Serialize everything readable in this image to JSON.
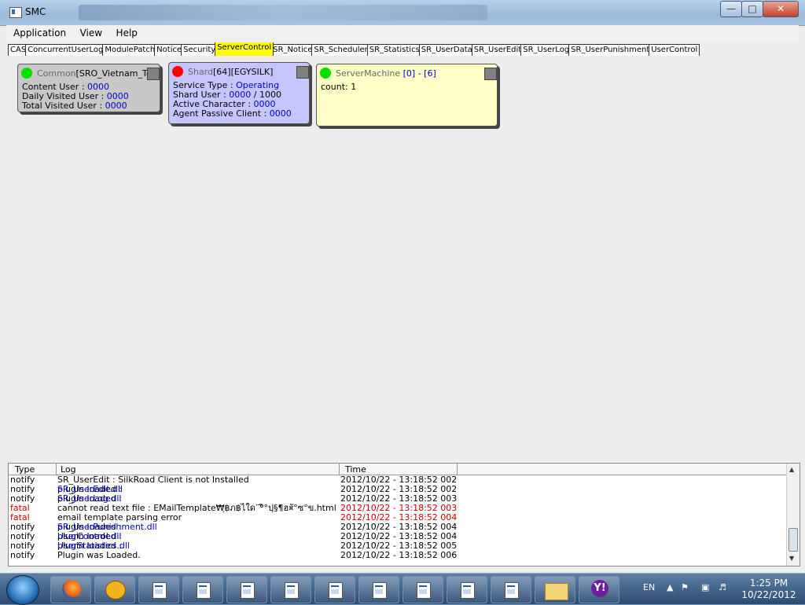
{
  "window": {
    "title": "SMC"
  },
  "menu": [
    "Application",
    "View",
    "Help"
  ],
  "tabs": [
    "CAS",
    "ConcurrentUserLog",
    "ModulePatch",
    "Notice",
    "Security",
    "ServerControl",
    "SR_Notice",
    "SR_Scheduler",
    "SR_Statistics",
    "SR_UserData",
    "SR_UserEdit",
    "SR_UserLog",
    "SR_UserPunishment",
    "UserControl"
  ],
  "active_tab": "ServerControl",
  "cards": {
    "common": {
      "status_color": "#00e000",
      "name_prefix": "Common",
      "name": "[SRO_Vietnam_TestLo",
      "content_user_label": "Content User : ",
      "content_user": "0000",
      "daily_visited_label": "Daily Visited User : ",
      "daily_visited": "0000",
      "total_visited_label": "Total Visited User : ",
      "total_visited": "0000"
    },
    "shard": {
      "status_color": "#ff0000",
      "name_prefix": "Shard",
      "id": "[64]",
      "name": "[EGYSILK]",
      "service_type_label": "Service Type : ",
      "service_type": "Operating",
      "shard_user_label": "Shard User : ",
      "shard_user": "0000",
      "shard_user_max": " / 1000",
      "active_char_label": "Active Character : ",
      "active_char": "0000",
      "agent_passive_label": "Agent Passive Client : ",
      "agent_passive": "0000"
    },
    "machine": {
      "status_color": "#00e000",
      "name_prefix": "ServerMachine ",
      "range": "[0] - [6]",
      "count": "count: 1"
    }
  },
  "log": {
    "headers": {
      "type": "Type",
      "log": "Log",
      "time": "Time"
    },
    "rows": [
      {
        "type": "notify",
        "pre": "SR_UserEdit : SilkRoad Client is not Installed",
        "link": "",
        "time": "2012/10/22 - 13:18:52 002",
        "level": "notify"
      },
      {
        "type": "notify",
        "pre": "plugin loaded : ",
        "link": "SR_UserEdit.dll",
        "time": "2012/10/22 - 13:18:52 002",
        "level": "notify"
      },
      {
        "type": "notify",
        "pre": "plugin loaded : ",
        "link": "SR_UserLog.dll",
        "time": "2012/10/22 - 13:18:52 003",
        "level": "notify"
      },
      {
        "type": "fatal",
        "pre": "cannot read text file : EMailTemplate₩ฺ฿ภ฿ไใด¨°ิ°ปฺ§¶ฮ¤ั°ซ°ข.html",
        "link": "",
        "time": "2012/10/22 - 13:18:52 003",
        "level": "fatal"
      },
      {
        "type": "fatal",
        "pre": "email template parsing error",
        "link": "",
        "time": "2012/10/22 - 13:18:52 004",
        "level": "fatal"
      },
      {
        "type": "notify",
        "pre": "plugin loaded : ",
        "link": "SR_UserPunishment.dll",
        "time": "2012/10/22 - 13:18:52 004",
        "level": "notify"
      },
      {
        "type": "notify",
        "pre": "plugin loaded : ",
        "link": "UserControl.dll",
        "time": "2012/10/22 - 13:18:52 004",
        "level": "notify"
      },
      {
        "type": "notify",
        "pre": "plugin loaded : ",
        "link": "UserStatistics.dll",
        "time": "2012/10/22 - 13:18:52 005",
        "level": "notify"
      },
      {
        "type": "notify",
        "pre": "Plugin was Loaded.",
        "link": "",
        "time": "2012/10/22 - 13:18:52 006",
        "level": "notify"
      }
    ]
  },
  "taskbar": {
    "language": "EN",
    "time": "1:25 PM",
    "date": "10/22/2012",
    "pinned": [
      "firefox-icon",
      "emulator-icon",
      "document-icon",
      "document-icon",
      "document-icon",
      "document-icon",
      "document-icon",
      "document-icon",
      "document-icon",
      "document-icon",
      "document-icon",
      "folder-icon",
      "yahoo-messenger-icon"
    ]
  }
}
